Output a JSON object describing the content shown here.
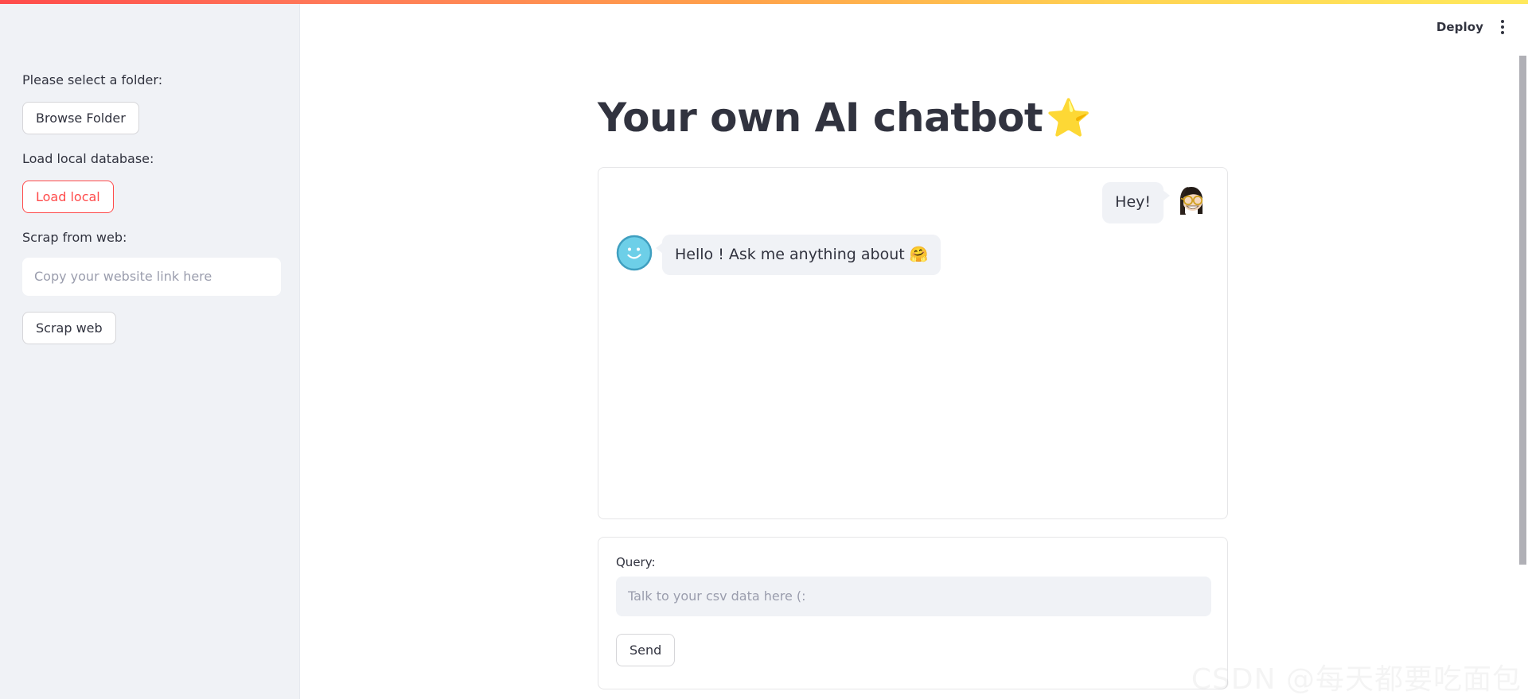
{
  "header": {
    "deploy_label": "Deploy",
    "menu_icon": "kebab-menu-icon",
    "progress_gradient_from": "#ff4b4b",
    "progress_gradient_to": "#ffe95c"
  },
  "sidebar": {
    "folder_label": "Please select a folder:",
    "browse_button": "Browse Folder",
    "database_label": "Load local database:",
    "load_local_button": "Load local",
    "load_local_color": "#ff4b4b",
    "scrap_label": "Scrap from web:",
    "url_input_value": "",
    "url_input_placeholder": "Copy your website link here",
    "scrap_button": "Scrap web",
    "background": "#f0f2f6"
  },
  "main": {
    "title": "Your own AI chatbot",
    "title_emoji": "⭐",
    "chat": {
      "messages": [
        {
          "role": "user",
          "text": "Hey!",
          "avatar": "nerd-face-avatar"
        },
        {
          "role": "bot",
          "text": "Hello ! Ask me anything about 🤗",
          "avatar": "smiley-bot-avatar",
          "avatar_color": "#6dcfe8"
        }
      ]
    },
    "form": {
      "query_label": "Query:",
      "query_value": "",
      "query_placeholder": "Talk to your csv data here (:",
      "send_button": "Send"
    }
  },
  "watermark": {
    "text": "CSDN @每天都要吃面包"
  }
}
